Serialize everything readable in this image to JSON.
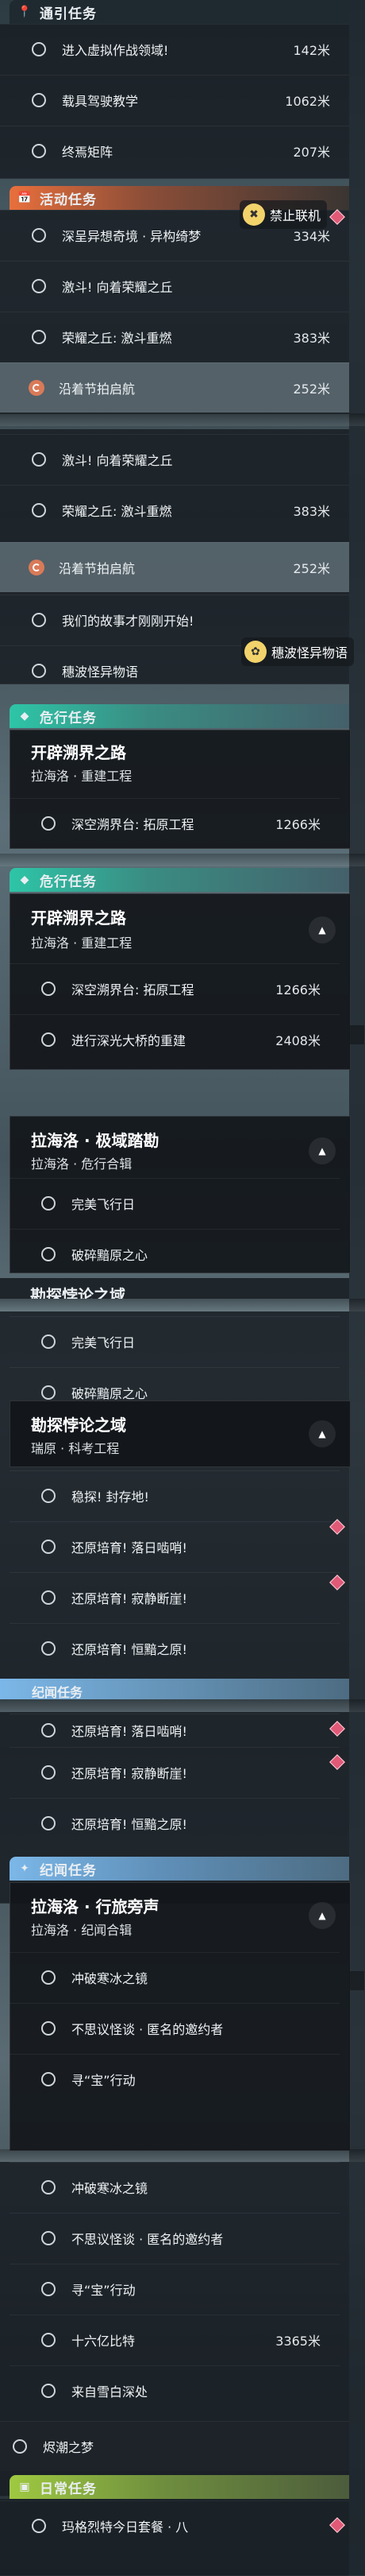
{
  "colors": {
    "event": "#e86f3c",
    "danger": "#2ec5a7",
    "story": "#7bb7e8",
    "daily": "#9fc941",
    "marker": "#e05a78"
  },
  "sections": {
    "guide": {
      "title": "通引任务",
      "icon": "map-pin-icon"
    },
    "event": {
      "title": "活动任务",
      "icon": "calendar-icon"
    },
    "danger": {
      "title": "危行任务",
      "icon": "danger-icon"
    },
    "story": {
      "title": "纪闻任务",
      "icon": "sparkle-icon"
    },
    "daily": {
      "title": "日常任务",
      "icon": "daily-icon"
    }
  },
  "guide_quests": [
    {
      "name": "进入虚拟作战领域!",
      "distance": "142米"
    },
    {
      "name": "载具驾驶教学",
      "distance": "1062米"
    },
    {
      "name": "终焉矩阵",
      "distance": "207米"
    }
  ],
  "event_quests_1": [
    {
      "name": "深呈异想奇境 · 异构绮梦",
      "distance": "334米"
    },
    {
      "name": "激斗! 向着荣耀之丘",
      "distance": ""
    },
    {
      "name": "荣耀之丘: 激斗重燃",
      "distance": "383米"
    },
    {
      "name": "沿着节拍启航",
      "distance": "252米"
    }
  ],
  "event_quests_2": [
    {
      "name": "激斗! 向着荣耀之丘",
      "distance": ""
    },
    {
      "name": "荣耀之丘: 激斗重燃",
      "distance": "383米"
    },
    {
      "name": "沿着节拍启航",
      "distance": "252米"
    },
    {
      "name": "我们的故事才刚刚开始!",
      "distance": ""
    },
    {
      "name": "穗波怪异物语",
      "distance": ""
    }
  ],
  "hints": {
    "no_coop": "禁止联机",
    "tale": "穗波怪异物语"
  },
  "groups": {
    "pioneer": {
      "title": "开辟溯界之路",
      "subtitle": "拉海洛 · 重建工程"
    },
    "tower": {
      "title": "拉海洛 · 极域踏勘",
      "subtitle": "拉海洛 · 危行合辑"
    },
    "domain": {
      "title": "勘探悖论之域",
      "subtitle": "瑞原 · 科考工程"
    },
    "journey": {
      "title": "拉海洛 · 行旅旁声",
      "subtitle": "拉海洛 · 纪闻合辑"
    }
  },
  "pioneer_quests": [
    {
      "name": "深空溯界台: 拓原工程",
      "distance": "1266米"
    },
    {
      "name": "进行深光大桥的重建",
      "distance": "2408米"
    }
  ],
  "tower_quests": [
    {
      "name": "完美飞行日",
      "distance": ""
    },
    {
      "name": "破碎黯原之心",
      "distance": ""
    }
  ],
  "domain_quests": [
    {
      "name": "稳探! 封存地!",
      "distance": ""
    },
    {
      "name": "还原培育! 落日啮哨!",
      "distance": ""
    },
    {
      "name": "还原培育! 寂静断崖!",
      "distance": ""
    },
    {
      "name": "还原培育! 恒黯之原!",
      "distance": ""
    }
  ],
  "journey_quests": [
    {
      "name": "冲破寒冰之镜",
      "distance": ""
    },
    {
      "name": "不思议怪谈 · 匿名的邀约者",
      "distance": ""
    },
    {
      "name": "寻“宝”行动",
      "distance": ""
    },
    {
      "name": "十六亿比特",
      "distance": "3365米"
    },
    {
      "name": "来自雪白深处",
      "distance": ""
    }
  ],
  "extra_quests": [
    {
      "name": "烬潮之梦",
      "distance": ""
    }
  ],
  "daily_quests": [
    {
      "name": "玛格烈特今日套餐 · 八",
      "distance": ""
    }
  ]
}
